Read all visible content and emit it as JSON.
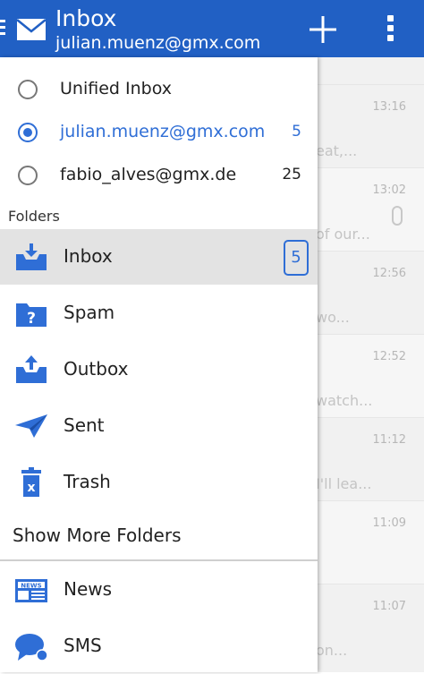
{
  "appbar": {
    "title": "Inbox",
    "subtitle": "julian.muenz@gmx.com",
    "color": "#2160c4"
  },
  "accounts": [
    {
      "label": "Unified Inbox",
      "count": ""
    },
    {
      "label": "julian.muenz@gmx.com",
      "count": "5",
      "selected": true
    },
    {
      "label": "fabio_alves@gmx.de",
      "count": "25"
    }
  ],
  "folders_heading": "Folders",
  "folders": [
    {
      "label": "Inbox",
      "icon": "inbox-icon",
      "badge": "5"
    },
    {
      "label": "Spam",
      "icon": "spam-icon"
    },
    {
      "label": "Outbox",
      "icon": "outbox-icon"
    },
    {
      "label": "Sent",
      "icon": "sent-icon"
    },
    {
      "label": "Trash",
      "icon": "trash-icon"
    }
  ],
  "show_more": "Show More Folders",
  "extras": [
    {
      "label": "News",
      "icon": "news-icon"
    },
    {
      "label": "SMS",
      "icon": "sms-icon"
    }
  ],
  "messages": [
    {
      "time": "13:16",
      "snippet": "eat,..."
    },
    {
      "time": "13:02",
      "snippet": "of our..."
    },
    {
      "time": "12:56",
      "snippet": "wo..."
    },
    {
      "time": "12:52",
      "snippet": "watch..."
    },
    {
      "time": "11:12",
      "snippet": "I'll lea..."
    },
    {
      "time": "11:09",
      "snippet": ""
    },
    {
      "time": "11:07",
      "snippet": "on..."
    }
  ],
  "accent": "#2f6ed6"
}
